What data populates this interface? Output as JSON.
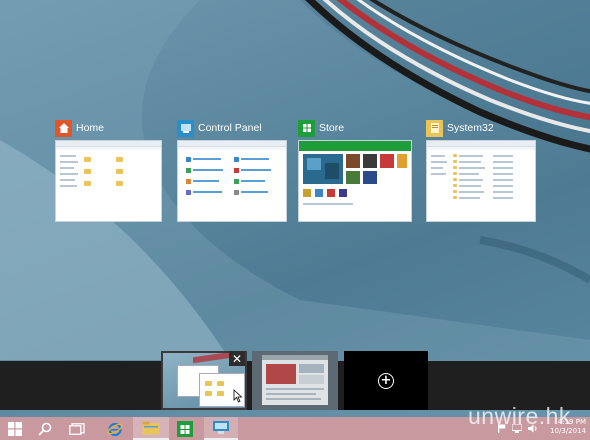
{
  "windows": [
    {
      "title": "Home",
      "icon": "home-folder-icon"
    },
    {
      "title": "Control Panel",
      "icon": "control-panel-icon"
    },
    {
      "title": "Store",
      "icon": "store-icon"
    },
    {
      "title": "System32",
      "icon": "folder-icon"
    }
  ],
  "virtual_desktops": {
    "close_glyph": "✕",
    "add_glyph": "+"
  },
  "taskbar": {
    "items": [
      "start-button",
      "search-button",
      "task-view-button",
      "internet-explorer",
      "file-explorer",
      "store",
      "control-panel"
    ],
    "clock_time": "4:19 PM",
    "clock_date": "10/3/2014"
  },
  "watermark": "unwire.hk",
  "colors": {
    "taskbar": "#c89aa0",
    "vd_bar": "#1f1f1f",
    "home_icon": "#e0552a",
    "control_panel_icon": "#2a8fc9",
    "store_icon": "#1e9e3a",
    "folder_icon": "#e8c45a"
  }
}
